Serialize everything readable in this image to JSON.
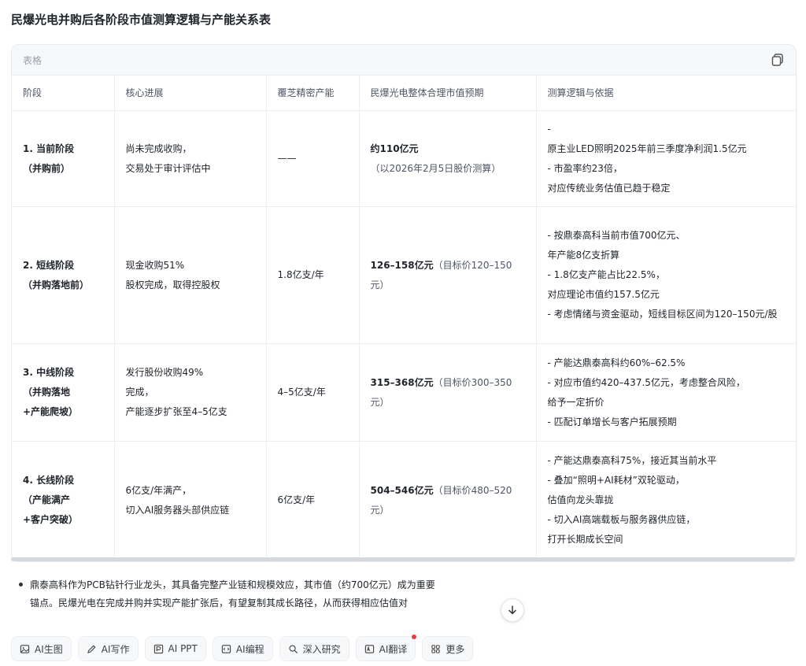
{
  "title": "民爆光电并购后各阶段市值测算逻辑与产能关系表",
  "table_label": "表格",
  "columns": [
    "阶段",
    "核心进展",
    "覆芝精密产能",
    "民爆光电整体合理市值预期",
    "测算逻辑与依据"
  ],
  "rows": [
    {
      "stage": [
        "1. 当前阶段",
        "（并购前）"
      ],
      "progress": [
        "尚未完成收购，",
        "交易处于审计评估中"
      ],
      "capacity": "——",
      "value_main": "约110亿元",
      "value_note": "（以2026年2月5日股价测算）",
      "logic": [
        "-",
        "原主业LED照明2025年前三季度净利润1.5亿元",
        "- 市盈率约23倍，",
        "对应传统业务估值已趋于稳定"
      ]
    },
    {
      "stage": [
        "2. 短线阶段",
        "（并购落地前）"
      ],
      "progress": [
        "现金收购51%",
        "股权完成，取得控股权"
      ],
      "capacity": "1.8亿支/年",
      "value_main": "126–158亿元",
      "value_note": "（目标价120–150元）",
      "logic": [
        "- 按鼎泰高科当前市值700亿元、",
        "年产能8亿支折算",
        "- 1.8亿支产能占比22.5%，",
        "对应理论市值约157.5亿元",
        "- 考虑情绪与资金驱动，短线目标区间为120–150元/股"
      ]
    },
    {
      "stage": [
        "3. 中线阶段",
        "（并购落地",
        "+产能爬坡）"
      ],
      "progress": [
        "发行股份收购49%",
        "完成，",
        "产能逐步扩张至4–5亿支"
      ],
      "capacity": "4–5亿支/年",
      "value_main": "315–368亿元",
      "value_note": "（目标价300–350元）",
      "logic": [
        "- 产能达鼎泰高科约60%–62.5%",
        "- 对应市值约420–437.5亿元，考虑整合风险，",
        "给予一定折价",
        "- 匹配订单增长与客户拓展预期"
      ]
    },
    {
      "stage": [
        "4. 长线阶段",
        "（产能满产",
        "+客户突破）"
      ],
      "progress": [
        "6亿支/年满产，",
        "切入AI服务器头部供应链"
      ],
      "capacity": "6亿支/年",
      "value_main": "504–546亿元",
      "value_note": "（目标价480–520元）",
      "logic": [
        "- 产能达鼎泰高科75%，接近其当前水平",
        "- 叠加“照明+AI耗材”双轮驱动，",
        "估值向龙头靠拢",
        "- 切入AI高端载板与服务器供应链，",
        "打开长期成长空间"
      ]
    }
  ],
  "notes": {
    "line1": "鼎泰高科作为PCB钻针行业龙头，其具备完整产业链和规模效应，其市值（约700亿元）成为重要",
    "line2": "锚点。民爆光电在完成并购并实现产能扩张后，有望复制其成长路径，从而获得相应估值对"
  },
  "toolbar": [
    {
      "label": "AI生图",
      "icon": "image-icon"
    },
    {
      "label": "AI写作",
      "icon": "pen-icon"
    },
    {
      "label": "AI PPT",
      "icon": "ppt-icon"
    },
    {
      "label": "AI编程",
      "icon": "code-icon"
    },
    {
      "label": "深入研究",
      "icon": "research-icon"
    },
    {
      "label": "AI翻译",
      "icon": "translate-icon"
    },
    {
      "label": "更多",
      "icon": "more-grid-icon"
    }
  ],
  "colors": {
    "accent_dot": "#e53e3e",
    "border": "#eceef2",
    "header_bg": "#f7f8fa"
  }
}
